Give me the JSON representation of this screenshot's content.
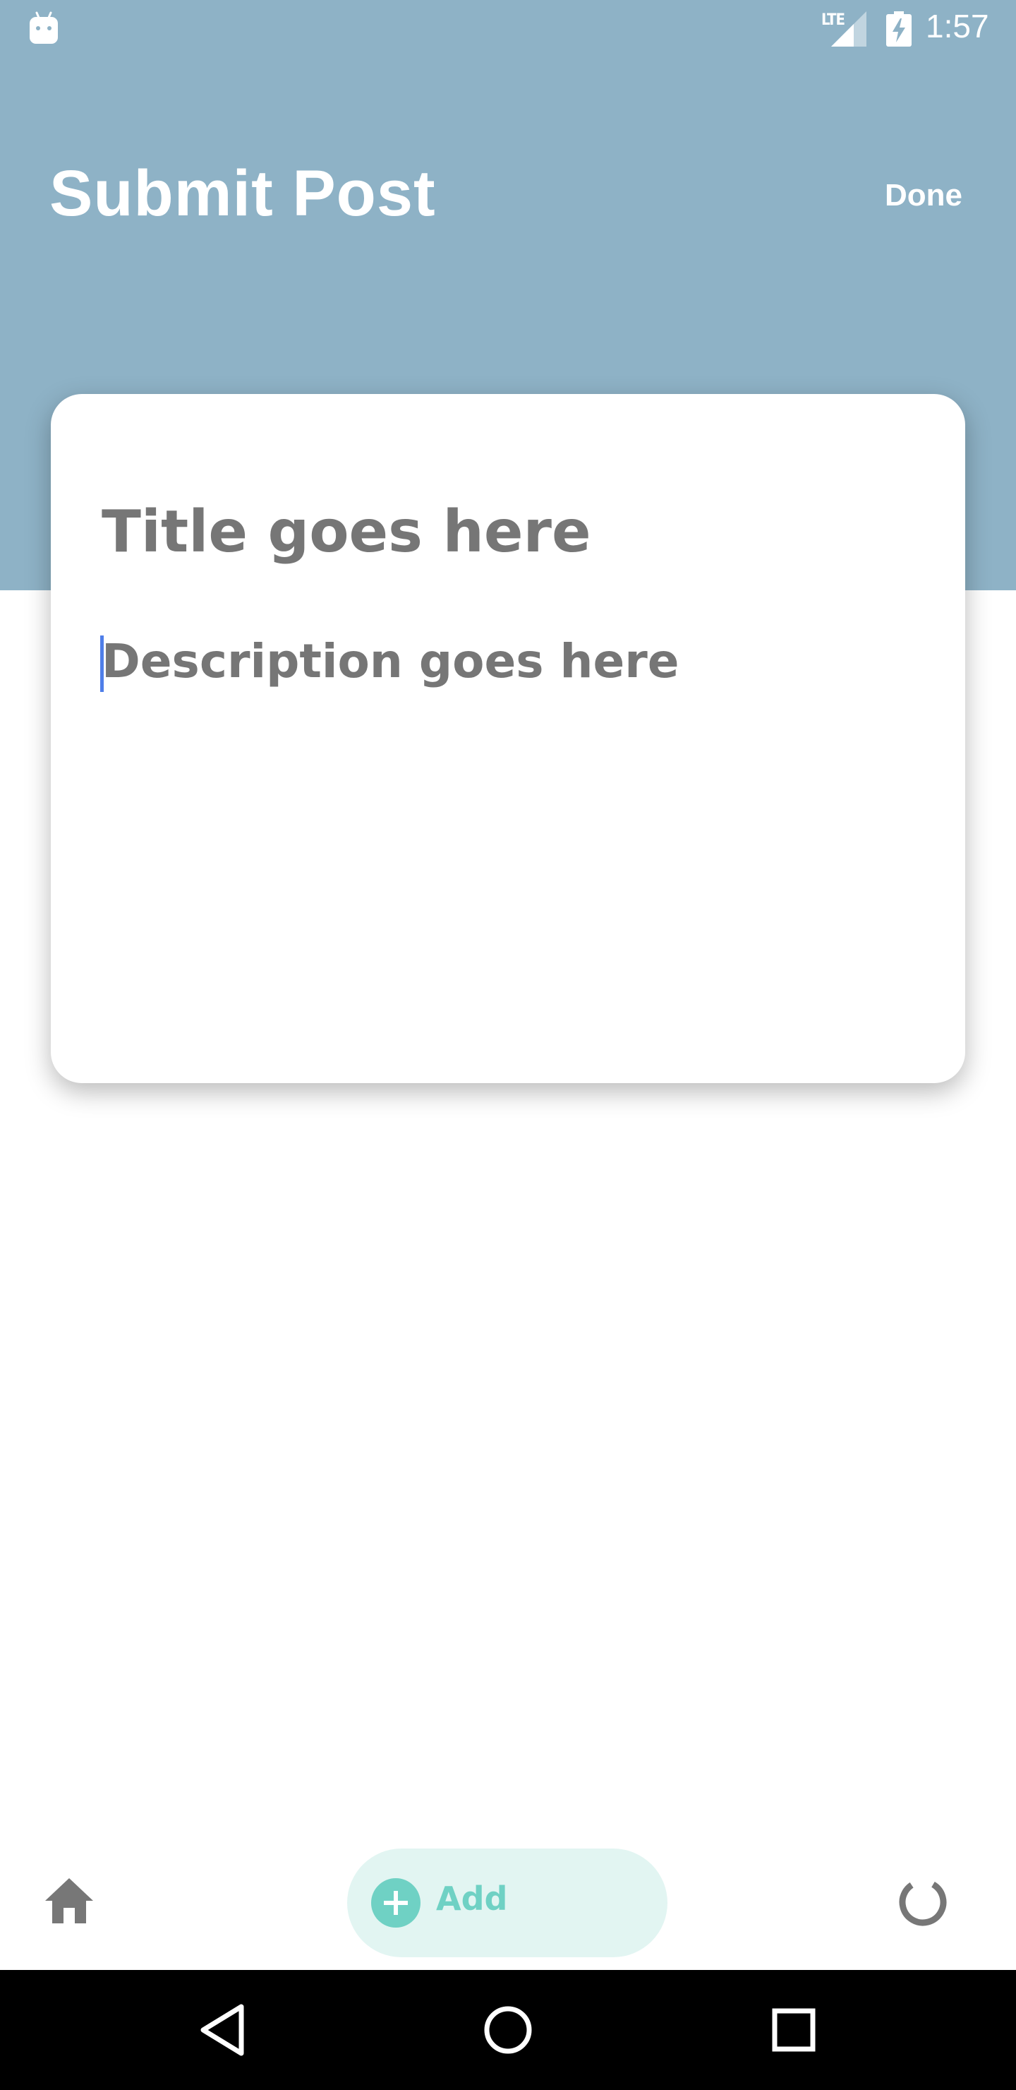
{
  "status_bar": {
    "network_label": "LTE",
    "time": "1:57",
    "icons": [
      "android-icon",
      "signal-icon",
      "battery-charging-icon"
    ]
  },
  "header": {
    "title": "Submit Post",
    "done_label": "Done"
  },
  "post_form": {
    "title_placeholder": "Title goes here",
    "description_placeholder": "Description goes here"
  },
  "bottom_nav": {
    "add_label": "Add",
    "icons": [
      "home-icon",
      "plus-icon",
      "loading-icon"
    ]
  },
  "system_nav": {
    "icons": [
      "back-icon",
      "home-circle-icon",
      "recents-icon"
    ]
  },
  "colors": {
    "header_bg": "#8eb2c6",
    "accent_teal": "#6fd1c4",
    "add_pill_bg": "#e2f5f2",
    "placeholder_gray": "#767676",
    "caret_blue": "#4f7ee9"
  }
}
